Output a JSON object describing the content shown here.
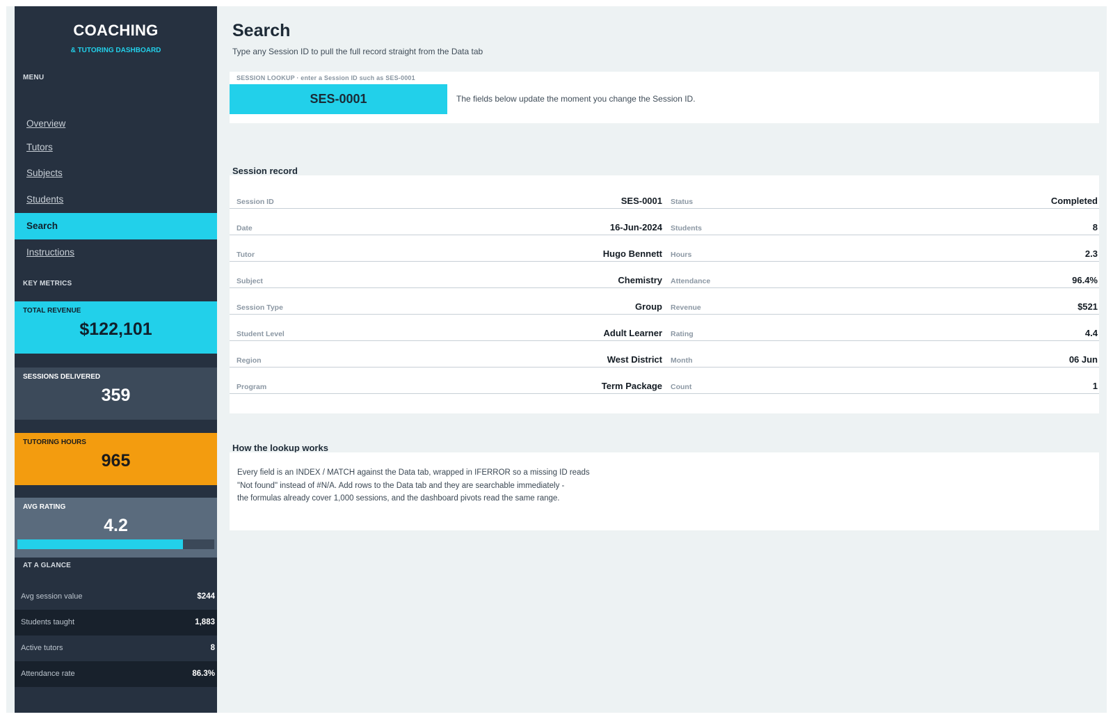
{
  "sidebar": {
    "brand_title": "COACHING",
    "brand_subtitle": "& TUTORING DASHBOARD",
    "menu_label": "MENU",
    "nav": [
      "Overview",
      "Tutors",
      "Subjects",
      "Students",
      "Search",
      "Instructions"
    ],
    "active_nav": "Search",
    "key_metrics_label": "KEY METRICS",
    "metrics": {
      "revenue": {
        "label": "TOTAL REVENUE",
        "value": "$122,101"
      },
      "sessions": {
        "label": "SESSIONS DELIVERED",
        "value": "359"
      },
      "hours": {
        "label": "TUTORING HOURS",
        "value": "965"
      },
      "rating": {
        "label": "AVG RATING",
        "value": "4.2",
        "bar_fraction": 0.84
      }
    },
    "glance_label": "AT A GLANCE",
    "glance": [
      {
        "label": "Avg session value",
        "value": "$244"
      },
      {
        "label": "Students taught",
        "value": "1,883"
      },
      {
        "label": "Active tutors",
        "value": "8"
      },
      {
        "label": "Attendance rate",
        "value": "86.3%"
      }
    ]
  },
  "main": {
    "title": "Search",
    "subtitle": "Type any Session ID to pull the full record straight from the Data tab",
    "lookup": {
      "label": "SESSION LOOKUP  ·  enter a Session ID such as SES-0001",
      "value": "SES-0001",
      "hint": "The fields below update the moment you change the Session ID."
    },
    "record_title": "Session record",
    "record_left": [
      {
        "label": "Session ID",
        "value": "SES-0001"
      },
      {
        "label": "Date",
        "value": "16-Jun-2024"
      },
      {
        "label": "Tutor",
        "value": "Hugo Bennett"
      },
      {
        "label": "Subject",
        "value": "Chemistry"
      },
      {
        "label": "Session Type",
        "value": "Group"
      },
      {
        "label": "Student Level",
        "value": "Adult Learner"
      },
      {
        "label": "Region",
        "value": "West District"
      },
      {
        "label": "Program",
        "value": "Term Package"
      }
    ],
    "record_right": [
      {
        "label": "Status",
        "value": "Completed"
      },
      {
        "label": "Students",
        "value": "8"
      },
      {
        "label": "Hours",
        "value": "2.3"
      },
      {
        "label": "Attendance",
        "value": "96.4%"
      },
      {
        "label": "Revenue",
        "value": "$521"
      },
      {
        "label": "Rating",
        "value": "4.4"
      },
      {
        "label": "Month",
        "value": "06 Jun"
      },
      {
        "label": "Count",
        "value": "1"
      }
    ],
    "how_title": "How the lookup works",
    "how_lines": [
      "Every field is an INDEX / MATCH against the Data tab, wrapped in IFERROR so a missing ID reads",
      "\"Not found\" instead of #N/A. Add rows to the Data tab and they are searchable immediately -",
      "the formulas already cover 1,000 sessions, and the dashboard pivots read the same range."
    ]
  }
}
